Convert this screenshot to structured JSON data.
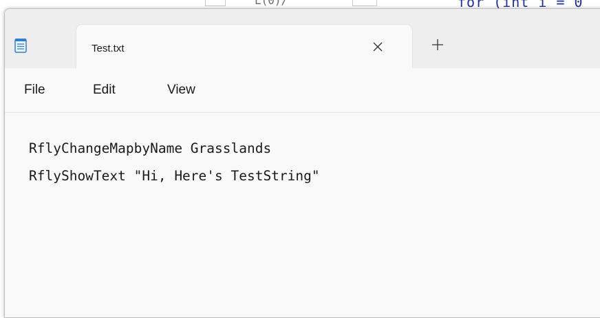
{
  "background_editor": {
    "code_fragment": "for (int i = 0",
    "left_fragment": "L(0)/"
  },
  "app": {
    "icon": "notepad-icon"
  },
  "tab": {
    "title": "Test.txt",
    "close_icon": "close-icon",
    "close_glyph": "✕"
  },
  "new_tab": {
    "icon": "plus-icon",
    "glyph": "+"
  },
  "menu": {
    "items": [
      {
        "label": "File"
      },
      {
        "label": "Edit"
      },
      {
        "label": "View"
      }
    ]
  },
  "document": {
    "lines": [
      "RflyChangeMapbyName Grasslands",
      "RflyShowText \"Hi, Here's TestString\""
    ]
  },
  "colors": {
    "window_bg": "#f3f3f3",
    "tab_bg": "#f9f9f9",
    "icon_accent": "#2b7fd4",
    "text": "#1a1a1a"
  }
}
